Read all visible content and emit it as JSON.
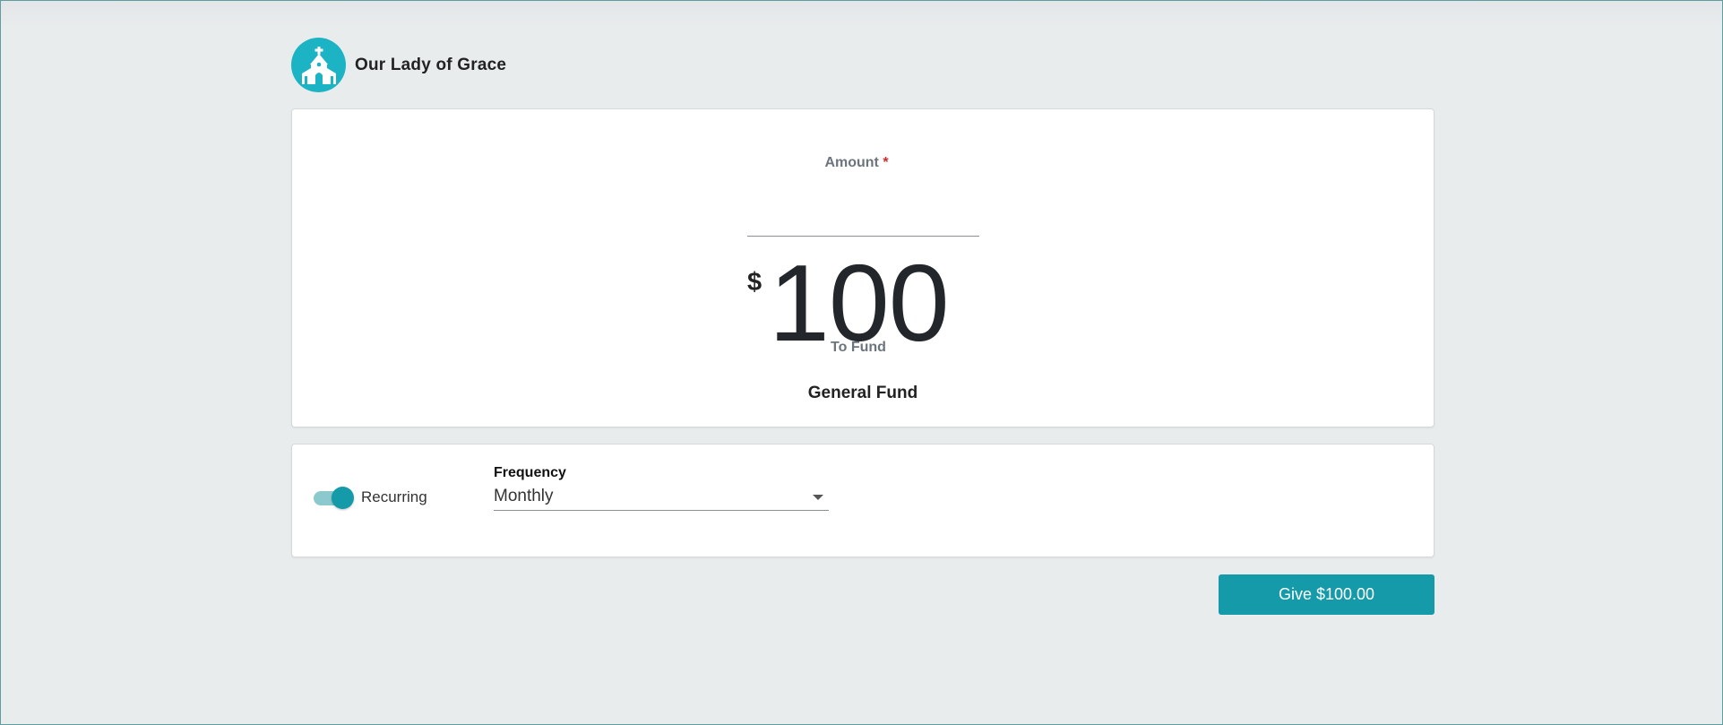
{
  "org": {
    "name": "Our Lady of Grace",
    "logo_icon": "church-icon",
    "brand_color": "#1cb3c4"
  },
  "donation": {
    "amount_label": "Amount",
    "required_marker": "*",
    "currency_symbol": "$",
    "amount_value": "100",
    "fund_label": "To Fund",
    "fund_value": "General Fund"
  },
  "recurring": {
    "toggle_on": true,
    "toggle_label": "Recurring",
    "frequency_label": "Frequency",
    "frequency_value": "Monthly",
    "dropdown_icon": "caret-down-icon"
  },
  "actions": {
    "give_label": "Give $100.00",
    "accent_color": "#159aaa"
  }
}
